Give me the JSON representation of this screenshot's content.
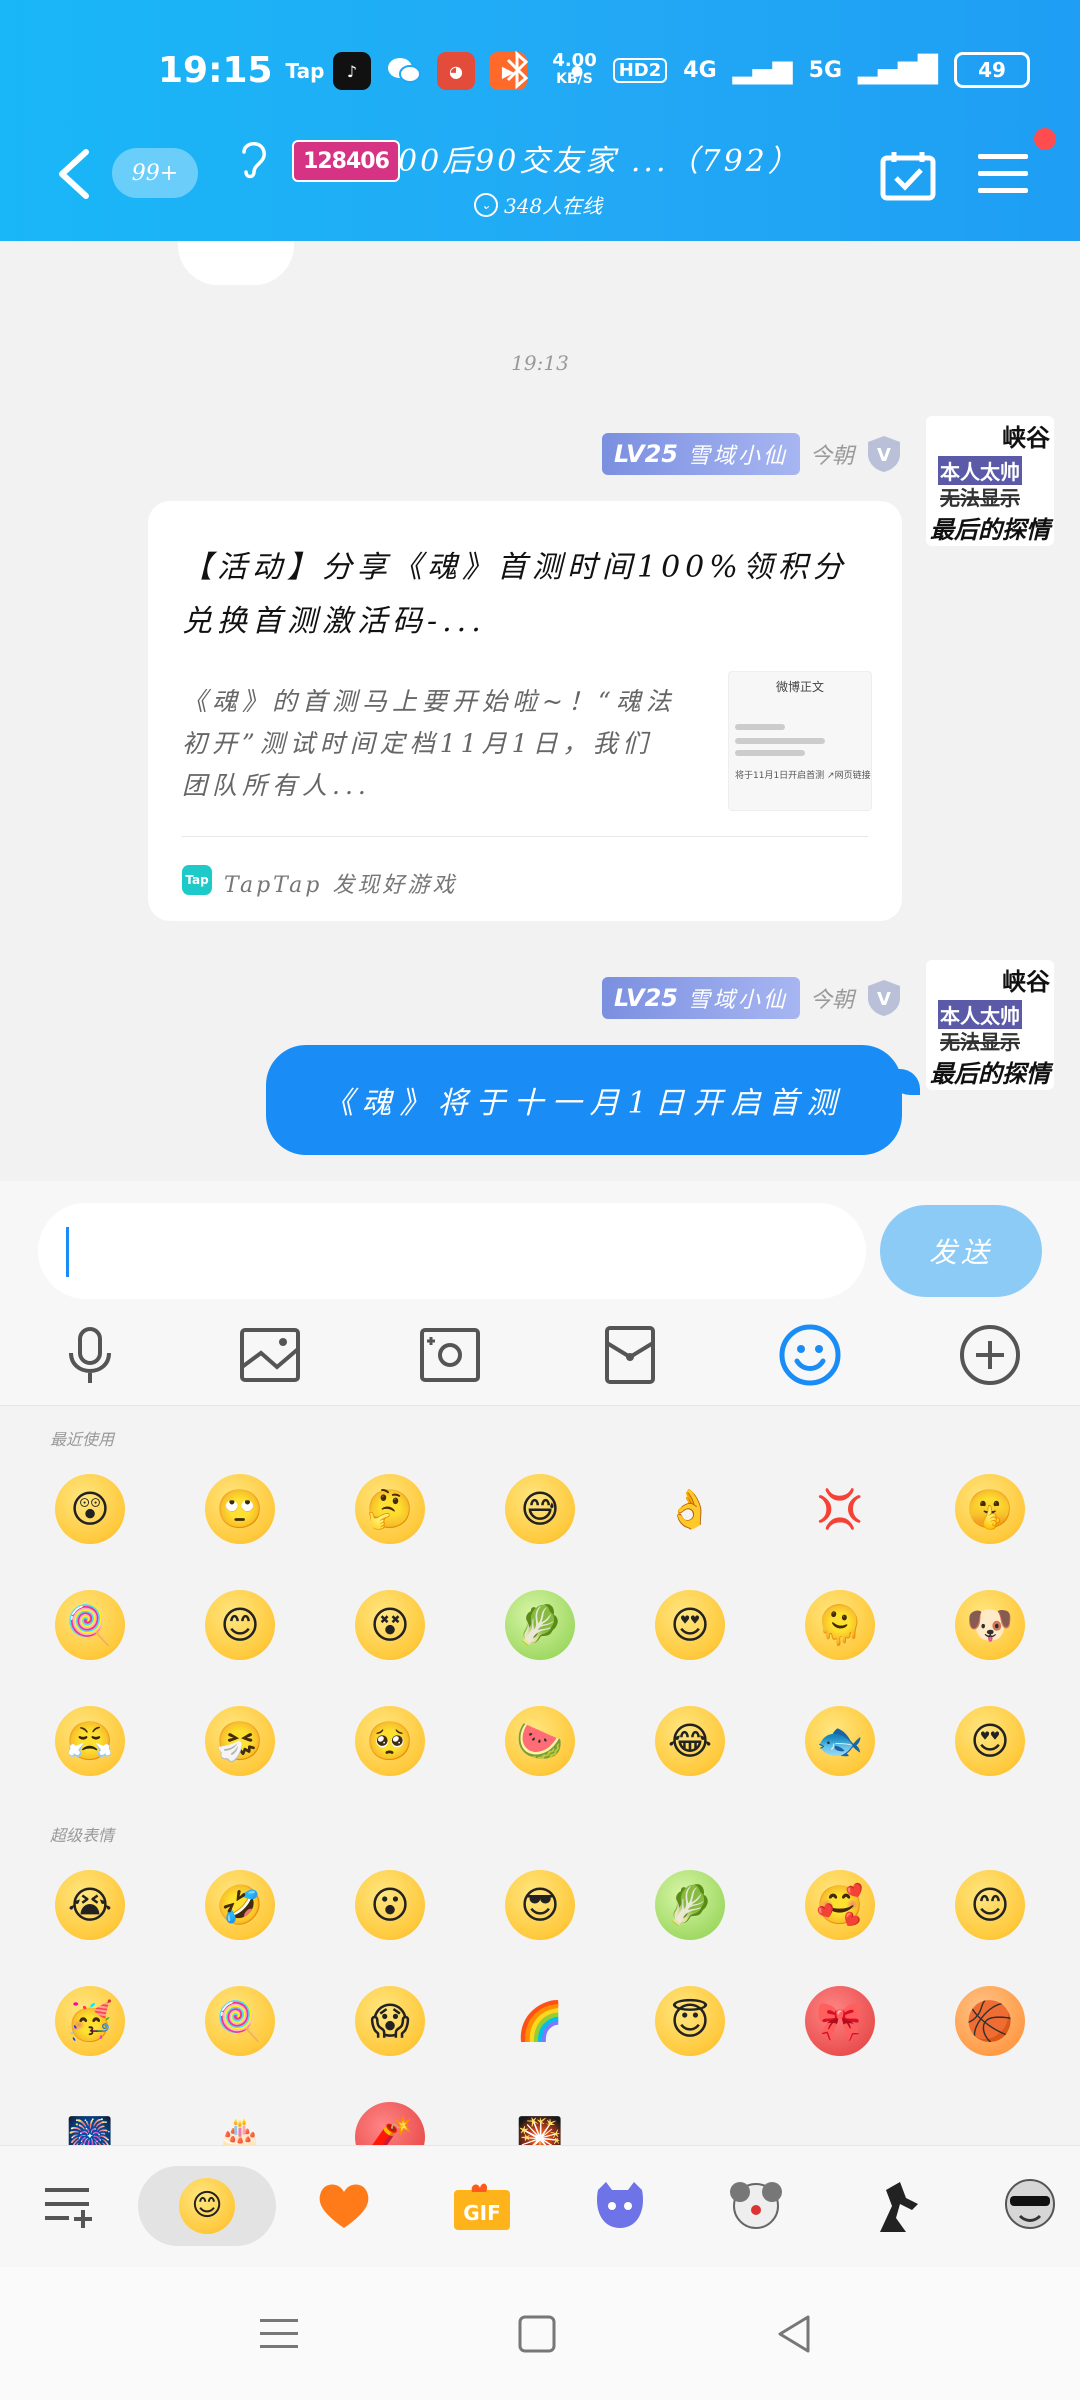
{
  "status_bar": {
    "time": "19:15",
    "tap_label": "Tap",
    "speed_value": "4.00",
    "speed_unit": "KB/S",
    "hd_label": "HD2",
    "net1": "4G",
    "net2": "5G",
    "battery": "49"
  },
  "header": {
    "badge": "99+",
    "group_logo": "128406",
    "group_title": "00后90交友家 ...（792）",
    "online": "348人在线"
  },
  "chat": {
    "timestamp": "19:13",
    "sender": {
      "level": "LV25",
      "title": "雪域小仙",
      "role": "今朝"
    },
    "avatar": {
      "line1": "峡谷",
      "line2": "本人太帅",
      "line3": "无法显示",
      "line4": "最后的探情"
    },
    "card": {
      "title": "【活动】分享《魂》首测时间100%领积分兑换首测激活码-...",
      "description": "《魂》的首测马上要开始啦~！“魂法初开”测试时间定档11月1日，我们团队所有人...",
      "thumb_title": "微博正文",
      "thumb_link": "将于11月1日开启首测 ↗网页链接",
      "source": "TapTap 发现好游戏"
    },
    "message": "《魂》将于十一月1日开启首测"
  },
  "input": {
    "value": "",
    "send_label": "发送"
  },
  "emoji": {
    "recent_label": "最近使用",
    "super_label": "超级表情",
    "recent": [
      "😲",
      "🙄",
      "🤔",
      "😅",
      "👌",
      "💢",
      "🤫",
      "🍭",
      "😊",
      "😵",
      "🥬",
      "😍",
      "🫠",
      "🐶",
      "😤",
      "🤧",
      "🥺",
      "🍉",
      "😂",
      "🐟",
      "😍"
    ],
    "super": [
      "😭",
      "🤣",
      "😮",
      "😎",
      "🥬",
      "🥰",
      "😊",
      "🥳",
      "🍭",
      "😱",
      "🌈",
      "😇",
      "🎀",
      "🏀",
      "🎆",
      "🎂",
      "🧨",
      "🎇"
    ]
  },
  "colors": {
    "header_bg": "#1ea8f5",
    "bubble_blue": "#1a8cf6",
    "send_button": "#8dcbf7",
    "badge_bg": "#8a9be6"
  }
}
